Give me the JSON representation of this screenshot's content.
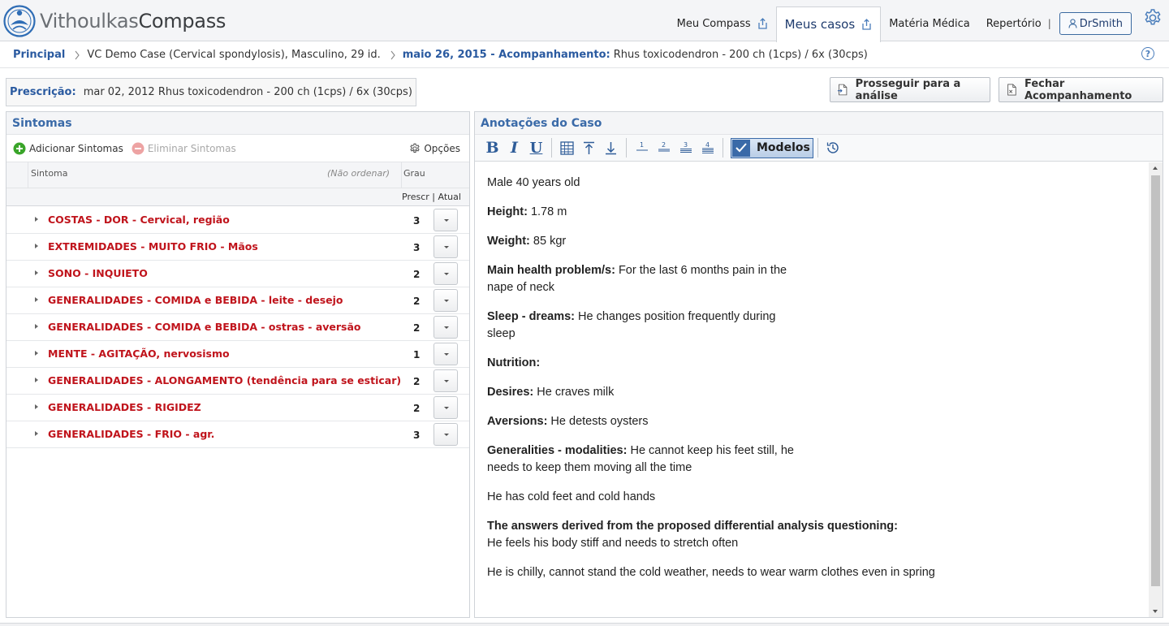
{
  "brand": {
    "part1": "Vithoulkas",
    "part2": "Compass"
  },
  "nav": {
    "meu_compass": "Meu Compass",
    "meus_casos": "Meus casos",
    "materia_medica": "Matéria Médica",
    "repertorio": "Repertório",
    "separator": "|",
    "user": "DrSmith"
  },
  "breadcrumb": {
    "home": "Principal",
    "case": "VC Demo Case (Cervical spondylosis), Masculino, 29 id.",
    "date": "maio 26, 2015 - Acompanhamento:",
    "followup": "Rhus toxicodendron - 200 ch (1cps) / 6x (30cps)",
    "help": "?"
  },
  "prescription": {
    "label": "Prescrição:",
    "value": "mar 02, 2012 Rhus toxicodendron - 200 ch (1cps) / 6x (30cps)"
  },
  "actions": {
    "proceed": "Prosseguir para a análise",
    "close": "Fechar Acompanhamento"
  },
  "symptoms_panel": {
    "title": "Sintomas",
    "add": "Adicionar Sintomas",
    "delete": "Eliminar Sintomas",
    "options": "Opções",
    "col_symptom": "Sintoma",
    "col_noorder": "(Não ordenar)",
    "col_grade": "Grau",
    "sub_header": "Prescr | Atual",
    "rows": [
      {
        "name": "COSTAS - DOR - Cervical, região",
        "grade": "3"
      },
      {
        "name": "EXTREMIDADES - MUITO FRIO - Mãos",
        "grade": "3"
      },
      {
        "name": "SONO - INQUIETO",
        "grade": "2"
      },
      {
        "name": "GENERALIDADES - COMIDA e BEBIDA - leite - desejo",
        "grade": "2"
      },
      {
        "name": "GENERALIDADES - COMIDA e BEBIDA - ostras - aversão",
        "grade": "2"
      },
      {
        "name": "MENTE - AGITAÇÃO, nervosismo",
        "grade": "1"
      },
      {
        "name": "GENERALIDADES - ALONGAMENTO (tendência para se esticar)",
        "grade": "2"
      },
      {
        "name": "GENERALIDADES - RIGIDEZ",
        "grade": "2"
      },
      {
        "name": "GENERALIDADES - FRIO - agr.",
        "grade": "3"
      }
    ]
  },
  "notes_panel": {
    "title": "Anotações do Caso",
    "toolbar": {
      "bold": "B",
      "italic": "I",
      "underline": "U",
      "h1": "1",
      "h2": "2",
      "h3": "3",
      "h4": "4",
      "templates": "Modelos"
    },
    "content": {
      "p1": "Male 40 years old",
      "p2_label": "Height:",
      "p2_text": " 1.78 m",
      "p3_label": "Weight:",
      "p3_text": " 85 kgr",
      "p4_label": "Main health problem/s:",
      "p4_text": " For the last 6 months pain in the nape of neck",
      "p5_label": "Sleep - dreams:",
      "p5_text": " He changes position frequently during sleep",
      "p6_label": "Nutrition:",
      "p7_label": "Desires:",
      "p7_text": " He craves milk",
      "p8_label": "Aversions:",
      "p8_text": " He detests oysters",
      "p9_label": "Generalities - modalities:",
      "p9_text": " He cannot keep his feet still, he needs to keep them moving all the time",
      "p10": "He has cold feet and cold hands",
      "p11_label": "The answers derived from the proposed differential analysis questioning:",
      "p11_text": "He feels his body stiff and needs to stretch often",
      "p12": "He is chilly, cannot stand the cold weather, needs to wear warm clothes even in spring"
    }
  },
  "colors": {
    "accent": "#2a5aa0",
    "symptom": "#c0141c",
    "add_green": "#3aa52a",
    "delete_red": "#e07070"
  }
}
